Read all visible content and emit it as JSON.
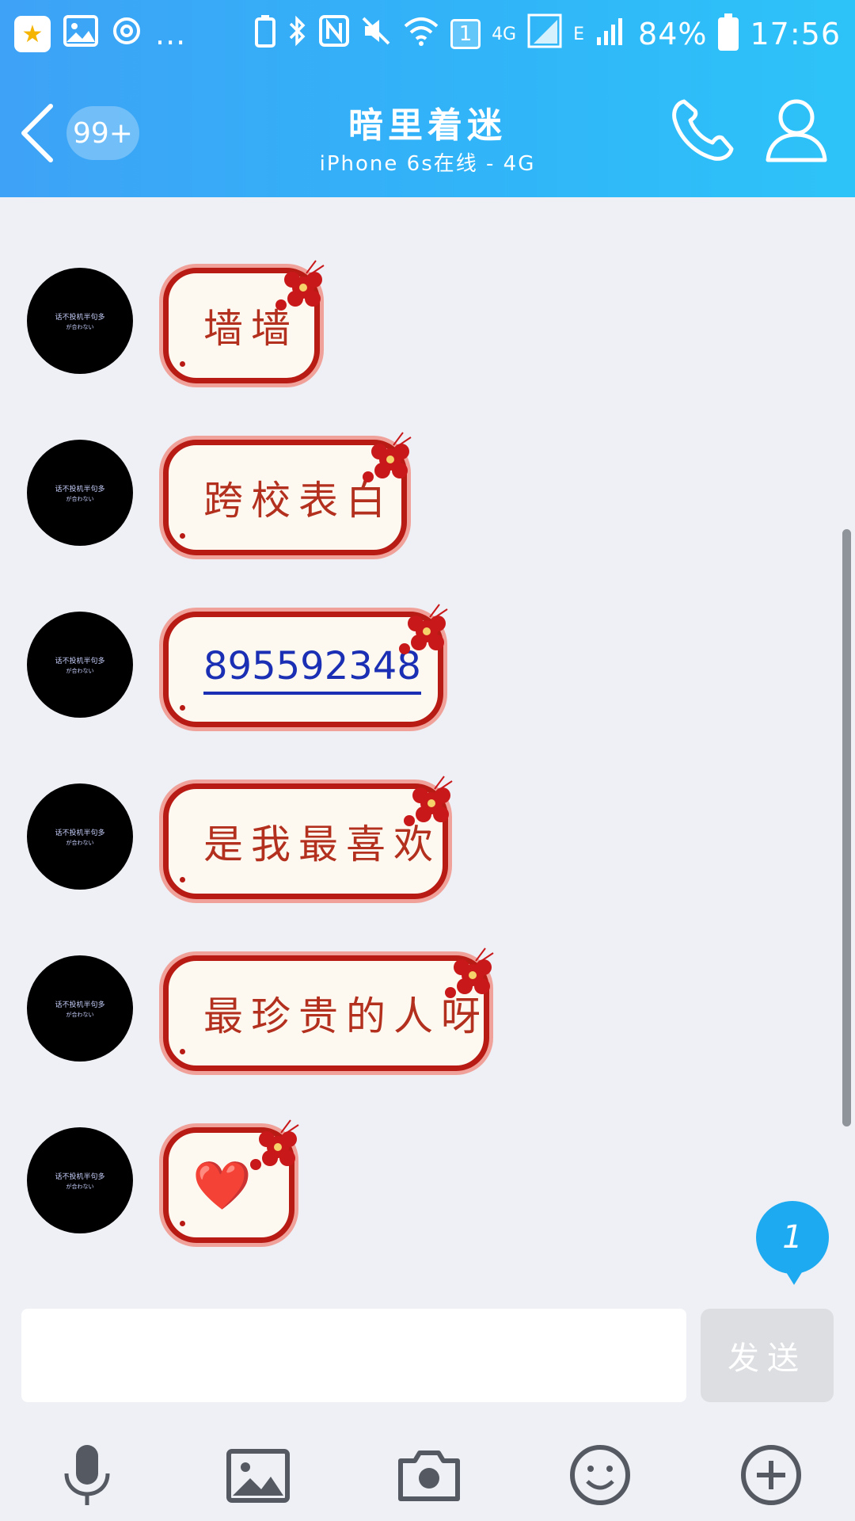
{
  "status_bar": {
    "left_icons": [
      "qzone-icon",
      "gallery-icon",
      "sync-icon"
    ],
    "more": "...",
    "sim_slot": "1",
    "network_1": "4G",
    "network_2": "E",
    "battery": "84%",
    "time": "17:56"
  },
  "header": {
    "unread_count": "99+",
    "title": "暗里着迷",
    "subtitle": "iPhone 6s在线 - 4G"
  },
  "avatar": {
    "line1": "话不投机半句多",
    "line2": "が合わない"
  },
  "messages": [
    {
      "text": "墙墙",
      "type": "text"
    },
    {
      "text": "跨校表白",
      "type": "text"
    },
    {
      "text": "895592348",
      "type": "link"
    },
    {
      "text": "是我最喜欢",
      "type": "text"
    },
    {
      "text": "最珍贵的人呀",
      "type": "text"
    },
    {
      "text": "❤️",
      "type": "emoji"
    }
  ],
  "unread_bubble": "1",
  "input": {
    "placeholder": "",
    "value": "",
    "send_label": "发送"
  },
  "toolbar_icons": [
    "microphone-icon",
    "image-icon",
    "camera-icon",
    "emoji-icon",
    "plus-icon"
  ],
  "colors": {
    "header_start": "#3ea2f6",
    "header_end": "#2dc3f8",
    "bubble_border": "#b81a14",
    "bubble_text": "#b3301f",
    "link": "#1a2fb3",
    "unread_badge": "#1eaaf0"
  }
}
